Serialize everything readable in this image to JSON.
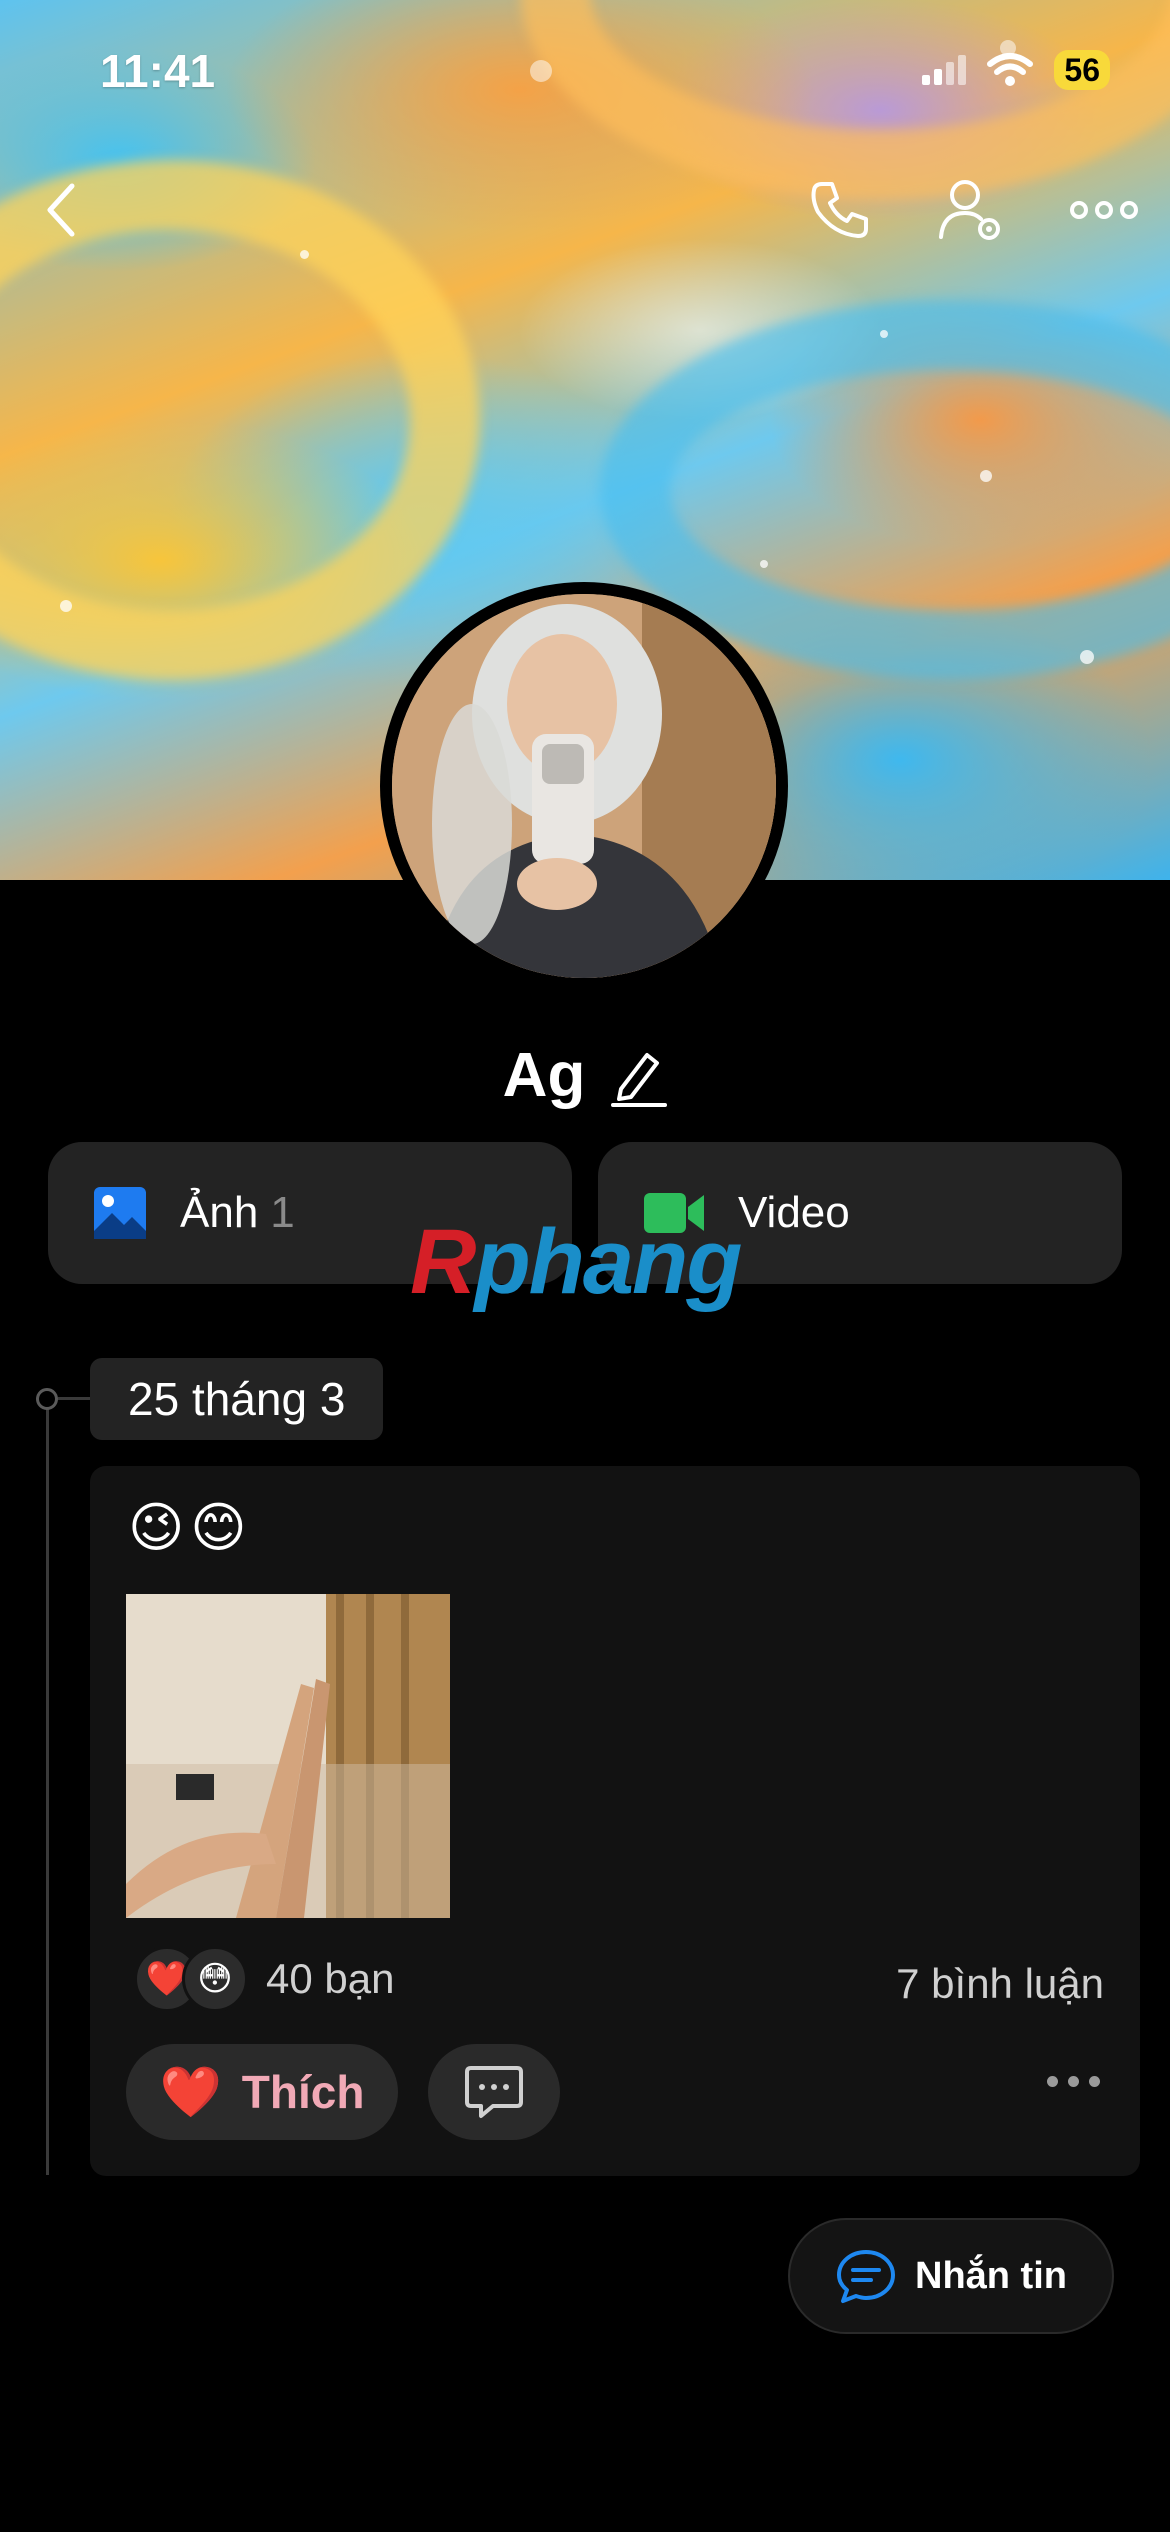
{
  "status_bar": {
    "time": "11:41",
    "battery": "56",
    "battery_color": "#f8d93a"
  },
  "header": {
    "back_icon": "chevron-left-icon",
    "call_icon": "phone-icon",
    "settings_icon": "user-settings-icon",
    "more_icon": "more-horizontal-icon"
  },
  "profile": {
    "name": "Ag",
    "edit_icon": "pencil-icon"
  },
  "media": {
    "photos_label": "Ảnh",
    "photos_count": "1",
    "videos_label": "Video"
  },
  "watermark": {
    "first": "R",
    "rest": "phang"
  },
  "timeline": {
    "date": "25 tháng 3"
  },
  "post": {
    "emojis": "😉😊",
    "reactions": [
      "❤️",
      "😳"
    ],
    "reactions_count": "40 bạn",
    "comments_count": "7 bình luận",
    "like_label": "Thích",
    "like_icon": "❤️"
  },
  "message_button": {
    "label": "Nhắn tin",
    "accent": "#1e88f0"
  }
}
